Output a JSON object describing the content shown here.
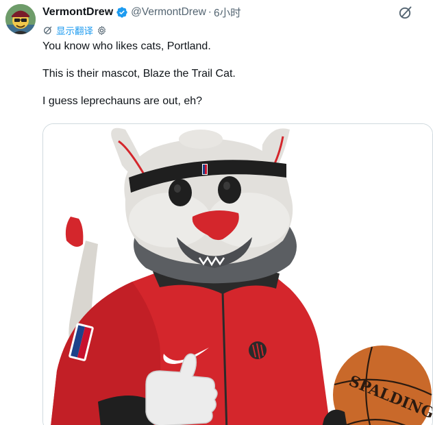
{
  "tweet": {
    "author": {
      "display_name": "VermontDrew",
      "handle": "@VermontDrew",
      "verified": true,
      "verified_color": "#1d9bf0"
    },
    "separator": "·",
    "time": "6小时",
    "translate": {
      "label": "显示翻译",
      "icon": "translate-icon",
      "settings_icon": "gear-icon"
    },
    "actions": {
      "grok_icon": "grok-icon"
    },
    "text": [
      "You know who likes cats, Portland.",
      "This is their mascot, Blaze the Trail Cat.",
      "I guess leprechauns are out, eh?"
    ],
    "media": {
      "kind": "photo",
      "ball_brand": "SPALDING"
    }
  },
  "colors": {
    "link": "#1d9bf0",
    "secondary_text": "#536471",
    "border": "#cfd9de",
    "jersey_red": "#d4262c"
  }
}
